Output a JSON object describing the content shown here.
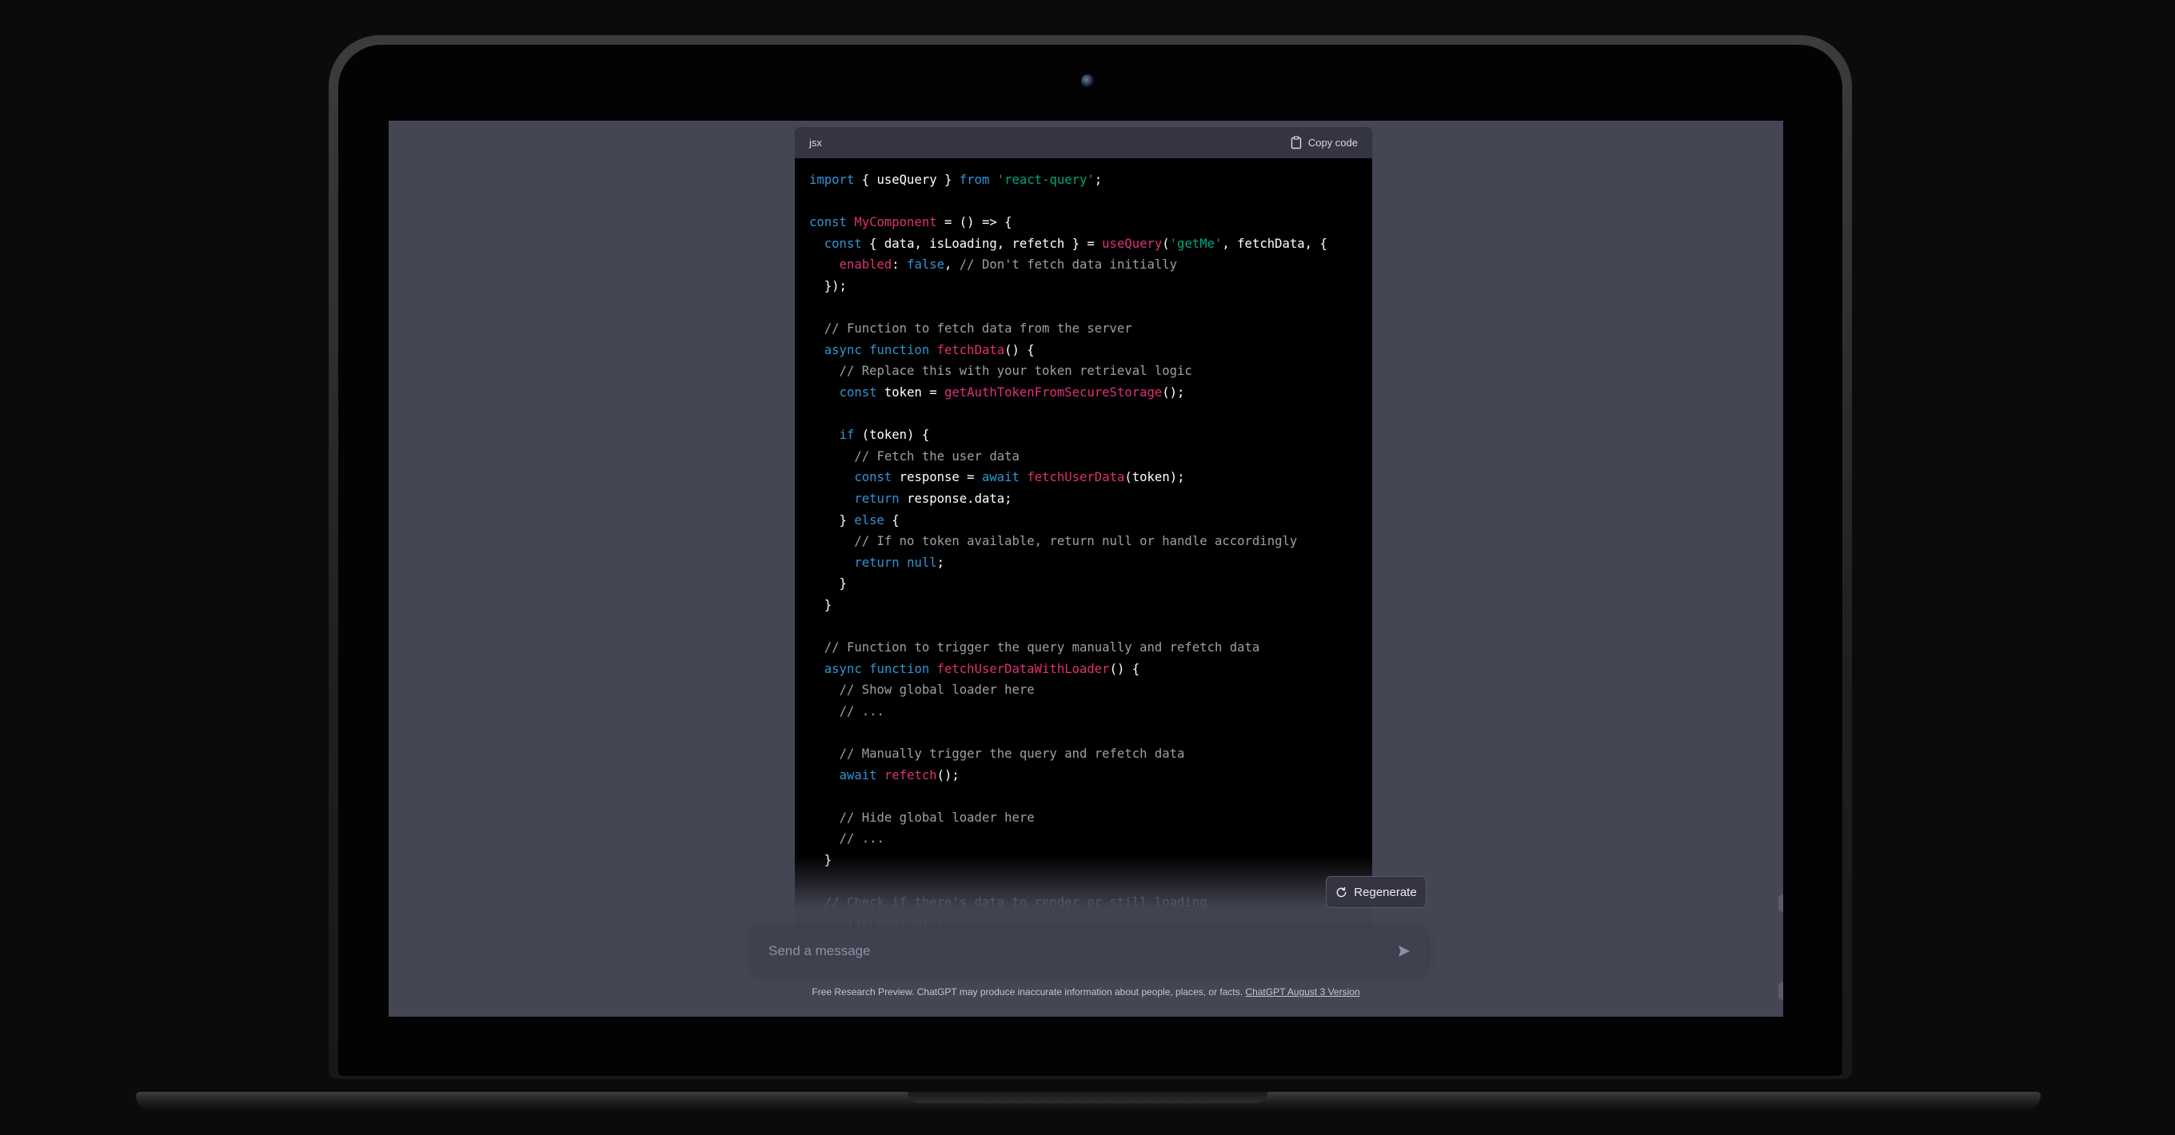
{
  "code_block": {
    "language": "jsx",
    "copy_label": "Copy code",
    "lines": [
      [
        {
          "t": "import",
          "c": "kw"
        },
        {
          "t": " { useQuery } ",
          "c": "pl"
        },
        {
          "t": "from",
          "c": "kw"
        },
        {
          "t": " ",
          "c": "pl"
        },
        {
          "t": "'react-query'",
          "c": "str"
        },
        {
          "t": ";",
          "c": "pl"
        }
      ],
      [],
      [
        {
          "t": "const",
          "c": "kw"
        },
        {
          "t": " ",
          "c": "pl"
        },
        {
          "t": "MyComponent",
          "c": "fn"
        },
        {
          "t": " = () => {",
          "c": "pl"
        }
      ],
      [
        {
          "t": "  ",
          "c": "pl"
        },
        {
          "t": "const",
          "c": "kw"
        },
        {
          "t": " { data, isLoading, refetch } = ",
          "c": "pl"
        },
        {
          "t": "useQuery",
          "c": "fn"
        },
        {
          "t": "(",
          "c": "pl"
        },
        {
          "t": "'getMe'",
          "c": "str"
        },
        {
          "t": ", fetchData, {",
          "c": "pl"
        }
      ],
      [
        {
          "t": "    ",
          "c": "pl"
        },
        {
          "t": "enabled",
          "c": "fn"
        },
        {
          "t": ": ",
          "c": "pl"
        },
        {
          "t": "false",
          "c": "kw"
        },
        {
          "t": ", ",
          "c": "pl"
        },
        {
          "t": "// Don't fetch data initially",
          "c": "cm"
        }
      ],
      [
        {
          "t": "  });",
          "c": "pl"
        }
      ],
      [],
      [
        {
          "t": "  ",
          "c": "pl"
        },
        {
          "t": "// Function to fetch data from the server",
          "c": "cm"
        }
      ],
      [
        {
          "t": "  ",
          "c": "pl"
        },
        {
          "t": "async",
          "c": "kw"
        },
        {
          "t": " ",
          "c": "pl"
        },
        {
          "t": "function",
          "c": "kw"
        },
        {
          "t": " ",
          "c": "pl"
        },
        {
          "t": "fetchData",
          "c": "fn"
        },
        {
          "t": "() {",
          "c": "pl"
        }
      ],
      [
        {
          "t": "    ",
          "c": "pl"
        },
        {
          "t": "// Replace this with your token retrieval logic",
          "c": "cm"
        }
      ],
      [
        {
          "t": "    ",
          "c": "pl"
        },
        {
          "t": "const",
          "c": "kw"
        },
        {
          "t": " token = ",
          "c": "pl"
        },
        {
          "t": "getAuthTokenFromSecureStorage",
          "c": "fn"
        },
        {
          "t": "();",
          "c": "pl"
        }
      ],
      [],
      [
        {
          "t": "    ",
          "c": "pl"
        },
        {
          "t": "if",
          "c": "kw"
        },
        {
          "t": " (token) {",
          "c": "pl"
        }
      ],
      [
        {
          "t": "      ",
          "c": "pl"
        },
        {
          "t": "// Fetch the user data",
          "c": "cm"
        }
      ],
      [
        {
          "t": "      ",
          "c": "pl"
        },
        {
          "t": "const",
          "c": "kw"
        },
        {
          "t": " response = ",
          "c": "pl"
        },
        {
          "t": "await",
          "c": "kw"
        },
        {
          "t": " ",
          "c": "pl"
        },
        {
          "t": "fetchUserData",
          "c": "fn"
        },
        {
          "t": "(token);",
          "c": "pl"
        }
      ],
      [
        {
          "t": "      ",
          "c": "pl"
        },
        {
          "t": "return",
          "c": "kw"
        },
        {
          "t": " response.data;",
          "c": "pl"
        }
      ],
      [
        {
          "t": "    } ",
          "c": "pl"
        },
        {
          "t": "else",
          "c": "kw"
        },
        {
          "t": " {",
          "c": "pl"
        }
      ],
      [
        {
          "t": "      ",
          "c": "pl"
        },
        {
          "t": "// If no token available, return null or handle accordingly",
          "c": "cm"
        }
      ],
      [
        {
          "t": "      ",
          "c": "pl"
        },
        {
          "t": "return",
          "c": "kw"
        },
        {
          "t": " ",
          "c": "pl"
        },
        {
          "t": "null",
          "c": "kw"
        },
        {
          "t": ";",
          "c": "pl"
        }
      ],
      [
        {
          "t": "    }",
          "c": "pl"
        }
      ],
      [
        {
          "t": "  }",
          "c": "pl"
        }
      ],
      [],
      [
        {
          "t": "  ",
          "c": "pl"
        },
        {
          "t": "// Function to trigger the query manually and refetch data",
          "c": "cm"
        }
      ],
      [
        {
          "t": "  ",
          "c": "pl"
        },
        {
          "t": "async",
          "c": "kw"
        },
        {
          "t": " ",
          "c": "pl"
        },
        {
          "t": "function",
          "c": "kw"
        },
        {
          "t": " ",
          "c": "pl"
        },
        {
          "t": "fetchUserDataWithLoader",
          "c": "fn"
        },
        {
          "t": "() {",
          "c": "pl"
        }
      ],
      [
        {
          "t": "    ",
          "c": "pl"
        },
        {
          "t": "// Show global loader here",
          "c": "cm"
        }
      ],
      [
        {
          "t": "    ",
          "c": "pl"
        },
        {
          "t": "// ...",
          "c": "cm"
        }
      ],
      [],
      [
        {
          "t": "    ",
          "c": "pl"
        },
        {
          "t": "// Manually trigger the query and refetch data",
          "c": "cm"
        }
      ],
      [
        {
          "t": "    ",
          "c": "pl"
        },
        {
          "t": "await",
          "c": "kw"
        },
        {
          "t": " ",
          "c": "pl"
        },
        {
          "t": "refetch",
          "c": "fn"
        },
        {
          "t": "();",
          "c": "pl"
        }
      ],
      [],
      [
        {
          "t": "    ",
          "c": "pl"
        },
        {
          "t": "// Hide global loader here",
          "c": "cm"
        }
      ],
      [
        {
          "t": "    ",
          "c": "pl"
        },
        {
          "t": "// ...",
          "c": "cm"
        }
      ],
      [
        {
          "t": "  }",
          "c": "pl"
        }
      ],
      [],
      [
        {
          "t": "  ",
          "c": "pl"
        },
        {
          "t": "// Check if there's data to render or still loading",
          "c": "cm"
        }
      ],
      [
        {
          "t": "  ",
          "c": "pl"
        },
        {
          "t": "if",
          "c": "kw"
        },
        {
          "t": " (isLoading) {",
          "c": "pl"
        }
      ]
    ]
  },
  "regenerate": {
    "label": "Regenerate",
    "icon": "refresh-icon"
  },
  "composer": {
    "placeholder": "Send a message",
    "send_icon": "send-icon"
  },
  "footer": {
    "text": "Free Research Preview. ChatGPT may produce inaccurate information about people, places, or facts.",
    "link_label": "ChatGPT August 3 Version"
  },
  "colors": {
    "keyword": "#2e95d3",
    "function": "#df3079",
    "string": "#00a67d",
    "comment": "#9aa0a6",
    "plain": "#ffffff",
    "screen_bg": "#444654",
    "code_bg": "#000000",
    "code_header_bg": "#343541",
    "composer_bg": "#40414f"
  }
}
